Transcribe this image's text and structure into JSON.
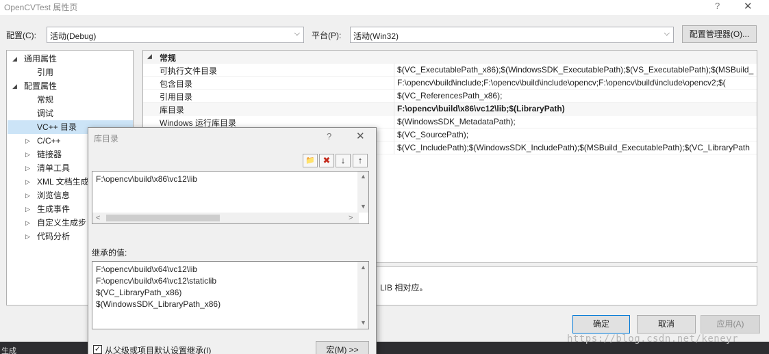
{
  "window": {
    "title": "OpenCVTest 属性页",
    "help_glyph": "?",
    "close_glyph": "✕"
  },
  "config": {
    "label": "配置(C):",
    "value": "活动(Debug)",
    "platform_label": "平台(P):",
    "platform_value": "活动(Win32)",
    "manager_button": "配置管理器(O)..."
  },
  "tree": {
    "items": [
      {
        "label": "通用属性",
        "expander": "◢"
      },
      {
        "label": "引用"
      },
      {
        "label": "配置属性",
        "expander": "◢"
      },
      {
        "label": "常规"
      },
      {
        "label": "调试"
      },
      {
        "label": "VC++ 目录"
      },
      {
        "label": "C/C++",
        "expander": "▷"
      },
      {
        "label": "链接器",
        "expander": "▷"
      },
      {
        "label": "清单工具",
        "expander": "▷"
      },
      {
        "label": "XML 文档生成",
        "expander": "▷"
      },
      {
        "label": "浏览信息",
        "expander": "▷"
      },
      {
        "label": "生成事件",
        "expander": "▷"
      },
      {
        "label": "自定义生成步",
        "expander": "▷"
      },
      {
        "label": "代码分析",
        "expander": "▷"
      }
    ]
  },
  "grid": {
    "section": "常规",
    "section_expander": "◢",
    "rows": [
      {
        "name": "可执行文件目录",
        "value": "$(VC_ExecutablePath_x86);$(WindowsSDK_ExecutablePath);$(VS_ExecutablePath);$(MSBuild_"
      },
      {
        "name": "包含目录",
        "value": "F:\\opencv\\build\\include;F:\\opencv\\build\\include\\opencv;F:\\opencv\\build\\include\\opencv2;$("
      },
      {
        "name": "引用目录",
        "value": "$(VC_ReferencesPath_x86);"
      },
      {
        "name": "库目录",
        "value": "F:\\opencv\\build\\x86\\vc12\\lib;$(LibraryPath)"
      },
      {
        "name": "Windows 运行库目录",
        "value": "$(WindowsSDK_MetadataPath);"
      },
      {
        "name": "",
        "value": "$(VC_SourcePath);"
      },
      {
        "name": "",
        "value": "$(VC_IncludePath);$(WindowsSDK_IncludePath);$(MSBuild_ExecutablePath);$(VC_LibraryPath"
      }
    ],
    "description_tail": "LIB 相对应。"
  },
  "dialog": {
    "title": "库目录",
    "help_glyph": "?",
    "close_glyph": "✕",
    "toolbar_glyphs": {
      "new_folder": "📁",
      "delete": "✖",
      "move_down": "↓",
      "move_up": "↑"
    },
    "entries": [
      "F:\\opencv\\build\\x86\\vc12\\lib"
    ],
    "inherited_label": "继承的值:",
    "inherited": [
      "F:\\opencv\\build\\x64\\vc12\\lib",
      "F:\\opencv\\build\\x64\\vc12\\staticlib",
      "$(VC_LibraryPath_x86)",
      "$(WindowsSDK_LibraryPath_x86)"
    ],
    "inherit_checkbox": "从父级或项目默认设置继承(I)",
    "inherit_checked": true,
    "check_glyph": "✓",
    "macro_button": "宏(M) >>"
  },
  "buttons": {
    "ok": "确定",
    "cancel": "取消",
    "apply": "应用(A)"
  },
  "bottom": {
    "status_text": "生成"
  },
  "watermark": "https://blog.csdn.net/keneyr",
  "scroll_glyphs": {
    "up": "▲",
    "down": "▼",
    "left": "<",
    "right": ">"
  },
  "colors": {
    "selection": "#cce4f7",
    "primary_border": "#0078d7",
    "delete_red": "#c42b1c"
  }
}
